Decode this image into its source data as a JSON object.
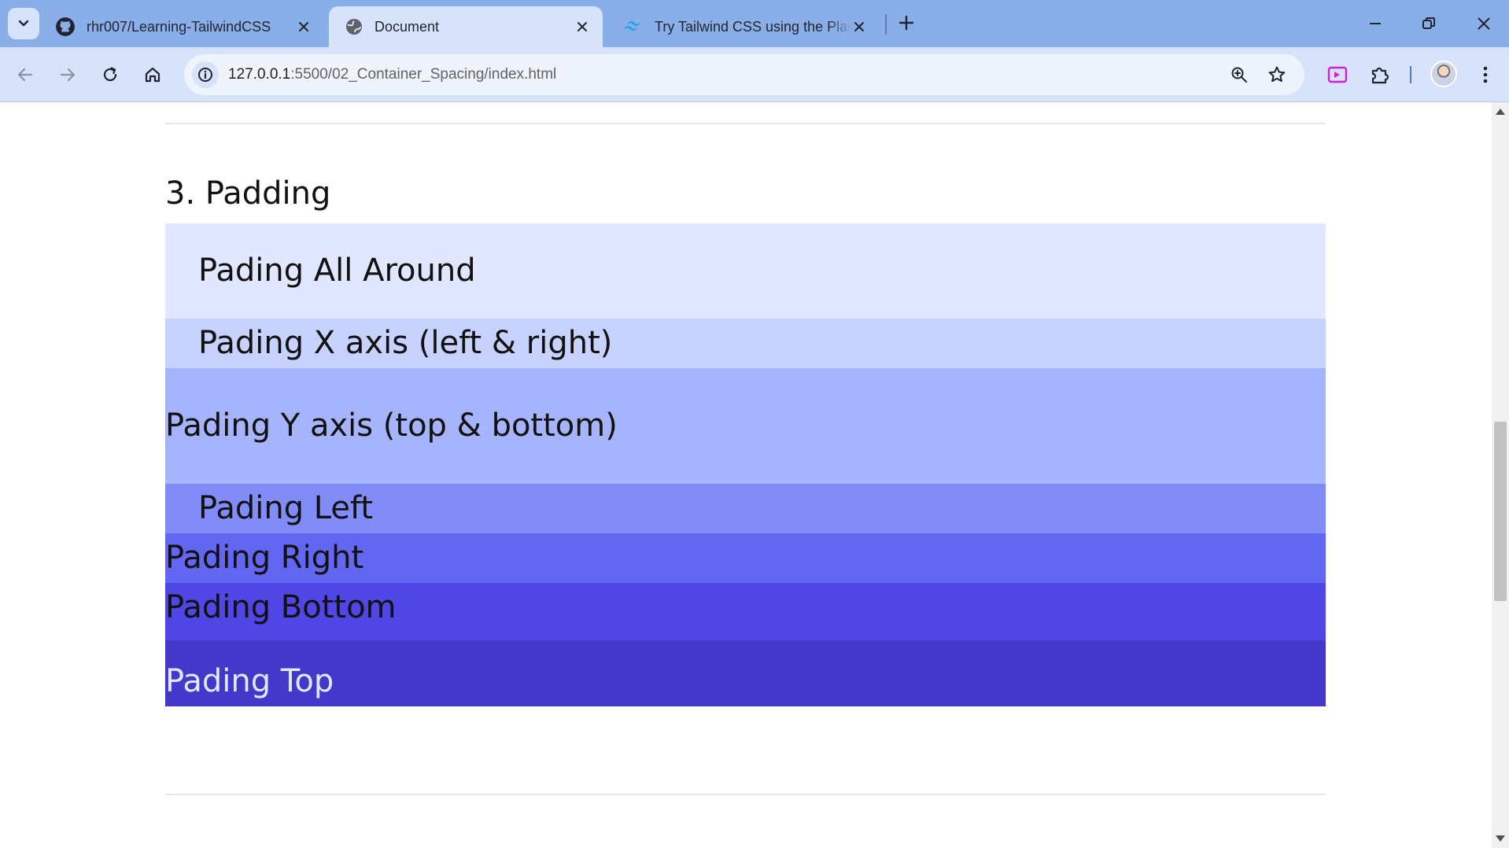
{
  "browser": {
    "tabs": [
      {
        "title": "rhr007/Learning-TailwindCSS",
        "icon": "github-icon",
        "active": false
      },
      {
        "title": "Document",
        "icon": "globe-icon",
        "active": true
      },
      {
        "title": "Try Tailwind CSS using the Play CDN",
        "icon": "tailwind-icon",
        "active": false
      }
    ],
    "url_host": "127.0.0.1",
    "url_path": ":5500/02_Container_Spacing/index.html"
  },
  "page": {
    "section_title": "3. Padding",
    "rows": [
      {
        "label": "Pading All Around",
        "color": "#e0e7ff"
      },
      {
        "label": "Pading X axis (left & right)",
        "color": "#c7d2fe"
      },
      {
        "label": "Pading Y axis (top & bottom)",
        "color": "#a5b4fc"
      },
      {
        "label": "Pading Left",
        "color": "#818cf8"
      },
      {
        "label": "Pading Right",
        "color": "#6366f1"
      },
      {
        "label": "Pading Bottom",
        "color": "#4f46e5"
      },
      {
        "label": "Pading Top",
        "color": "#4338ca"
      }
    ]
  }
}
